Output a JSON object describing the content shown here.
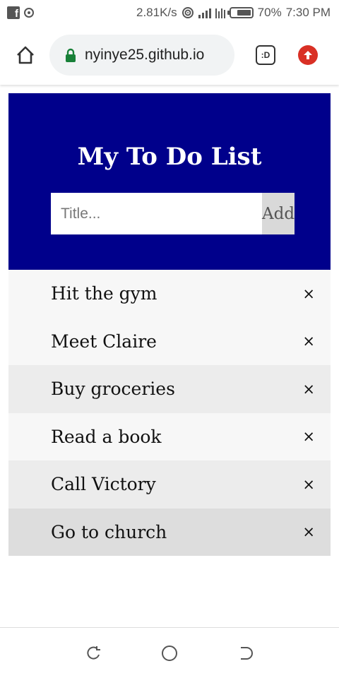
{
  "status_bar": {
    "speed": "2.81K/s",
    "battery": "70%",
    "battery_level": 0.7,
    "time": "7:30 PM"
  },
  "browser": {
    "url": "nyinye25.github.io",
    "tab_icon_label": ":D"
  },
  "app": {
    "title": "My To Do List",
    "input_placeholder": "Title...",
    "input_value": "",
    "add_label": "Add",
    "close_glyph": "×",
    "items": [
      {
        "text": "Hit the gym",
        "shade": "light"
      },
      {
        "text": "Meet Claire",
        "shade": "light"
      },
      {
        "text": "Buy groceries",
        "shade": "mid"
      },
      {
        "text": "Read a book",
        "shade": "light"
      },
      {
        "text": "Call Victory",
        "shade": "mid"
      },
      {
        "text": "Go to church",
        "shade": "dark"
      }
    ]
  },
  "colors": {
    "header_bg": "#00008b",
    "add_button_bg": "#d9d9d9",
    "upload_accent": "#d93025"
  },
  "icons": {
    "status_left": [
      "facebook-icon",
      "record-icon"
    ],
    "status_right": [
      "hotspot-icon",
      "signal-icon",
      "data-icon",
      "battery-icon"
    ],
    "browser": [
      "home-icon",
      "lock-icon",
      "tab-switcher-icon",
      "upload-icon"
    ],
    "nav": [
      "back-icon",
      "home-circle-icon",
      "recents-icon"
    ]
  }
}
